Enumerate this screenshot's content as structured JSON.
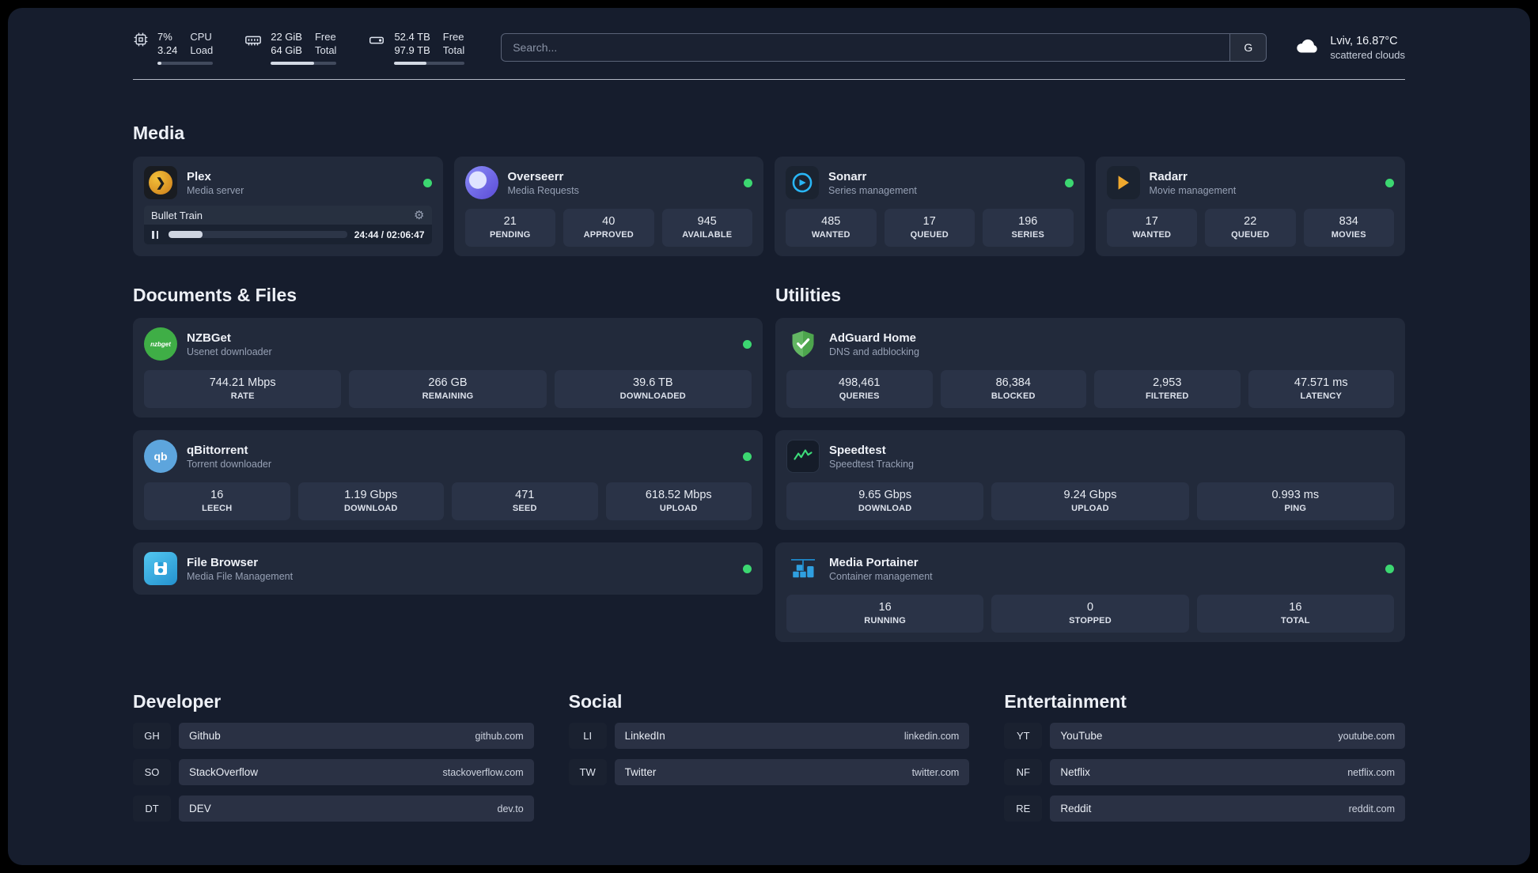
{
  "header": {
    "cpu": {
      "usage": "7%",
      "load": "3.24",
      "label_top": "CPU",
      "label_bottom": "Load",
      "percent": 7
    },
    "ram": {
      "free": "22 GiB",
      "total": "64 GiB",
      "label_top": "Free",
      "label_bottom": "Total",
      "percent": 66
    },
    "disk": {
      "free": "52.4 TB",
      "total": "97.9 TB",
      "label_top": "Free",
      "label_bottom": "Total",
      "percent": 46
    },
    "search": {
      "placeholder": "Search...",
      "engine_button": "G"
    },
    "weather": {
      "location": "Lviv, 16.87°C",
      "condition": "scattered clouds"
    }
  },
  "icons": {
    "plex_chevron": "❯",
    "gear": "⚙",
    "nzbget_text": "nzbget",
    "qb_text": "qb"
  },
  "sections": {
    "media": {
      "title": "Media",
      "plex": {
        "title": "Plex",
        "subtitle": "Media server",
        "now_playing": {
          "title": "Bullet Train",
          "time": "24:44 / 02:06:47",
          "progress_percent": 19
        }
      },
      "overseerr": {
        "title": "Overseerr",
        "subtitle": "Media Requests",
        "stats": [
          {
            "value": "21",
            "label": "PENDING"
          },
          {
            "value": "40",
            "label": "APPROVED"
          },
          {
            "value": "945",
            "label": "AVAILABLE"
          }
        ]
      },
      "sonarr": {
        "title": "Sonarr",
        "subtitle": "Series management",
        "stats": [
          {
            "value": "485",
            "label": "WANTED"
          },
          {
            "value": "17",
            "label": "QUEUED"
          },
          {
            "value": "196",
            "label": "SERIES"
          }
        ]
      },
      "radarr": {
        "title": "Radarr",
        "subtitle": "Movie management",
        "stats": [
          {
            "value": "17",
            "label": "WANTED"
          },
          {
            "value": "22",
            "label": "QUEUED"
          },
          {
            "value": "834",
            "label": "MOVIES"
          }
        ]
      }
    },
    "documents": {
      "title": "Documents & Files",
      "nzbget": {
        "title": "NZBGet",
        "subtitle": "Usenet downloader",
        "stats": [
          {
            "value": "744.21 Mbps",
            "label": "RATE"
          },
          {
            "value": "266 GB",
            "label": "REMAINING"
          },
          {
            "value": "39.6 TB",
            "label": "DOWNLOADED"
          }
        ]
      },
      "qbittorrent": {
        "title": "qBittorrent",
        "subtitle": "Torrent downloader",
        "stats": [
          {
            "value": "16",
            "label": "LEECH"
          },
          {
            "value": "1.19 Gbps",
            "label": "DOWNLOAD"
          },
          {
            "value": "471",
            "label": "SEED"
          },
          {
            "value": "618.52 Mbps",
            "label": "UPLOAD"
          }
        ]
      },
      "filebrowser": {
        "title": "File Browser",
        "subtitle": "Media File Management"
      }
    },
    "utilities": {
      "title": "Utilities",
      "adguard": {
        "title": "AdGuard Home",
        "subtitle": "DNS and adblocking",
        "stats": [
          {
            "value": "498,461",
            "label": "QUERIES"
          },
          {
            "value": "86,384",
            "label": "BLOCKED"
          },
          {
            "value": "2,953",
            "label": "FILTERED"
          },
          {
            "value": "47.571 ms",
            "label": "LATENCY"
          }
        ]
      },
      "speedtest": {
        "title": "Speedtest",
        "subtitle": "Speedtest Tracking",
        "stats": [
          {
            "value": "9.65 Gbps",
            "label": "DOWNLOAD"
          },
          {
            "value": "9.24 Gbps",
            "label": "UPLOAD"
          },
          {
            "value": "0.993 ms",
            "label": "PING"
          }
        ]
      },
      "portainer": {
        "title": "Media Portainer",
        "subtitle": "Container management",
        "stats": [
          {
            "value": "16",
            "label": "RUNNING"
          },
          {
            "value": "0",
            "label": "STOPPED"
          },
          {
            "value": "16",
            "label": "TOTAL"
          }
        ]
      }
    },
    "bookmarks": {
      "developer": {
        "title": "Developer",
        "items": [
          {
            "abbr": "GH",
            "name": "Github",
            "url": "github.com"
          },
          {
            "abbr": "SO",
            "name": "StackOverflow",
            "url": "stackoverflow.com"
          },
          {
            "abbr": "DT",
            "name": "DEV",
            "url": "dev.to"
          }
        ]
      },
      "social": {
        "title": "Social",
        "items": [
          {
            "abbr": "LI",
            "name": "LinkedIn",
            "url": "linkedin.com"
          },
          {
            "abbr": "TW",
            "name": "Twitter",
            "url": "twitter.com"
          }
        ]
      },
      "entertainment": {
        "title": "Entertainment",
        "items": [
          {
            "abbr": "YT",
            "name": "YouTube",
            "url": "youtube.com"
          },
          {
            "abbr": "NF",
            "name": "Netflix",
            "url": "netflix.com"
          },
          {
            "abbr": "RE",
            "name": "Reddit",
            "url": "reddit.com"
          }
        ]
      }
    }
  }
}
